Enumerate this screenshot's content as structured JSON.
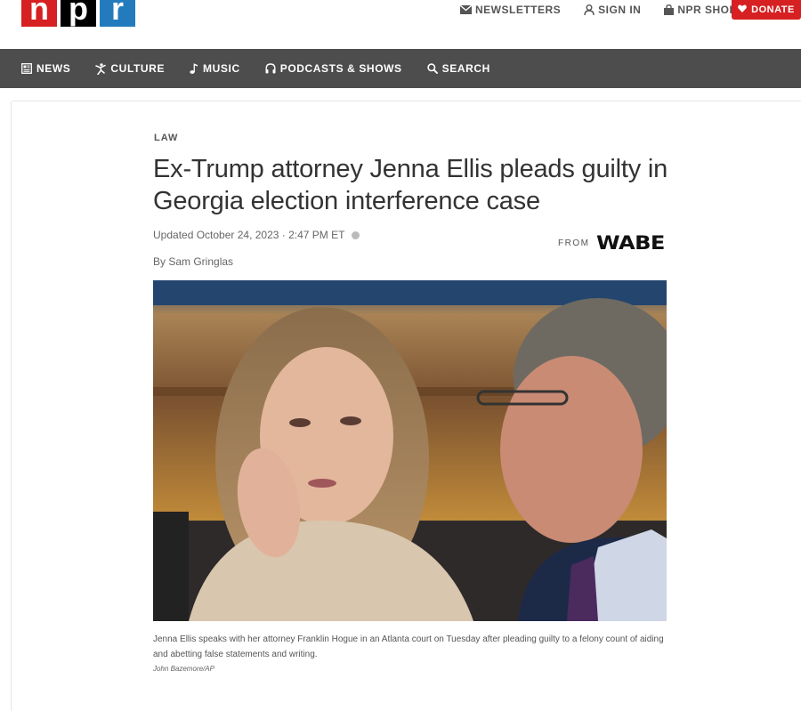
{
  "brand": {
    "letters": [
      "n",
      "p",
      "r"
    ]
  },
  "toplinks": [
    {
      "label": "NEWSLETTERS",
      "icon": "envelope-icon"
    },
    {
      "label": "SIGN IN",
      "icon": "user-icon"
    },
    {
      "label": "NPR SHOP",
      "icon": "shopping-bag-icon"
    }
  ],
  "donate": {
    "label": "DONATE",
    "icon": "heart-icon"
  },
  "nav": [
    {
      "label": "NEWS",
      "icon": "newspaper-icon"
    },
    {
      "label": "CULTURE",
      "icon": "dancer-icon"
    },
    {
      "label": "MUSIC",
      "icon": "music-note-icon"
    },
    {
      "label": "PODCASTS & SHOWS",
      "icon": "headphones-icon"
    },
    {
      "label": "SEARCH",
      "icon": "search-icon"
    }
  ],
  "article": {
    "kicker": "LAW",
    "headline": "Ex-Trump attorney Jenna Ellis pleads guilty in Georgia election interference case",
    "updated": "Updated October 24, 2023 · 2:47 PM ET",
    "byline": "By Sam Gringlas",
    "from_label": "FROM",
    "station": "WABE",
    "caption": "Jenna Ellis speaks with her attorney Franklin Hogue in an Atlanta court on Tuesday after pleading guilty to a felony count of aiding and abetting false statements and writing.",
    "credit": "John Bazemore/AP"
  },
  "colors": {
    "brand_red": "#d62021",
    "brand_blue": "#237bbd",
    "nav_bg": "#4d4d4d"
  }
}
